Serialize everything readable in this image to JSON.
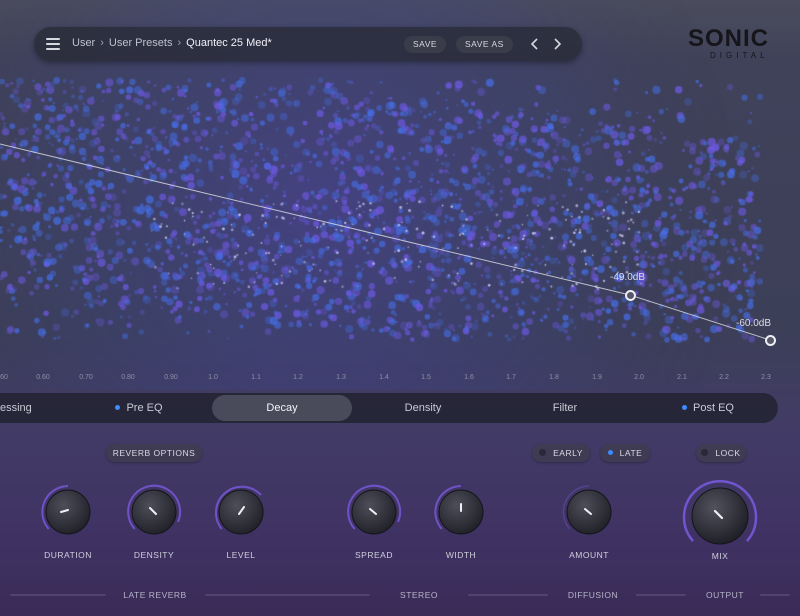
{
  "header": {
    "breadcrumb": [
      "User",
      "User Presets",
      "Quantec 25 Med*"
    ],
    "save_label": "SAVE",
    "save_as_label": "SAVE AS"
  },
  "logo": {
    "main": "SONIC",
    "sub": "DIGITAL"
  },
  "decay_display": {
    "node_labels": [
      "-49.0dB",
      "-60.0dB"
    ],
    "time_ticks": [
      "60",
      "0.60",
      "0.70",
      "0.80",
      "0.90",
      "1.0",
      "1.1",
      "1.2",
      "1.3",
      "1.4",
      "1.5",
      "1.6",
      "1.7",
      "1.8",
      "1.9",
      "2.0",
      "2.1",
      "2.2",
      "2.3"
    ]
  },
  "tabs": [
    {
      "label": "essing"
    },
    {
      "label": "Pre EQ",
      "indicator": true
    },
    {
      "label": "Decay",
      "active": true
    },
    {
      "label": "Density"
    },
    {
      "label": "Filter"
    },
    {
      "label": "Post EQ",
      "indicator": true
    }
  ],
  "options": {
    "reverb_options": "REVERB OPTIONS",
    "early": "EARLY",
    "late": "LATE",
    "lock": "LOCK"
  },
  "knobs": {
    "duration": "DURATION",
    "density": "DENSITY",
    "level": "LEVEL",
    "spread": "SPREAD",
    "width": "WIDTH",
    "amount": "AMOUNT",
    "mix": "MIX"
  },
  "sections": {
    "late_reverb": "LATE REVERB",
    "stereo": "STEREO",
    "diffusion": "DIFFUSION",
    "output": "OUTPUT"
  },
  "colors": {
    "accent": "#3d8bff",
    "arc": "#7a5ae0",
    "background": "#3c3f58"
  }
}
